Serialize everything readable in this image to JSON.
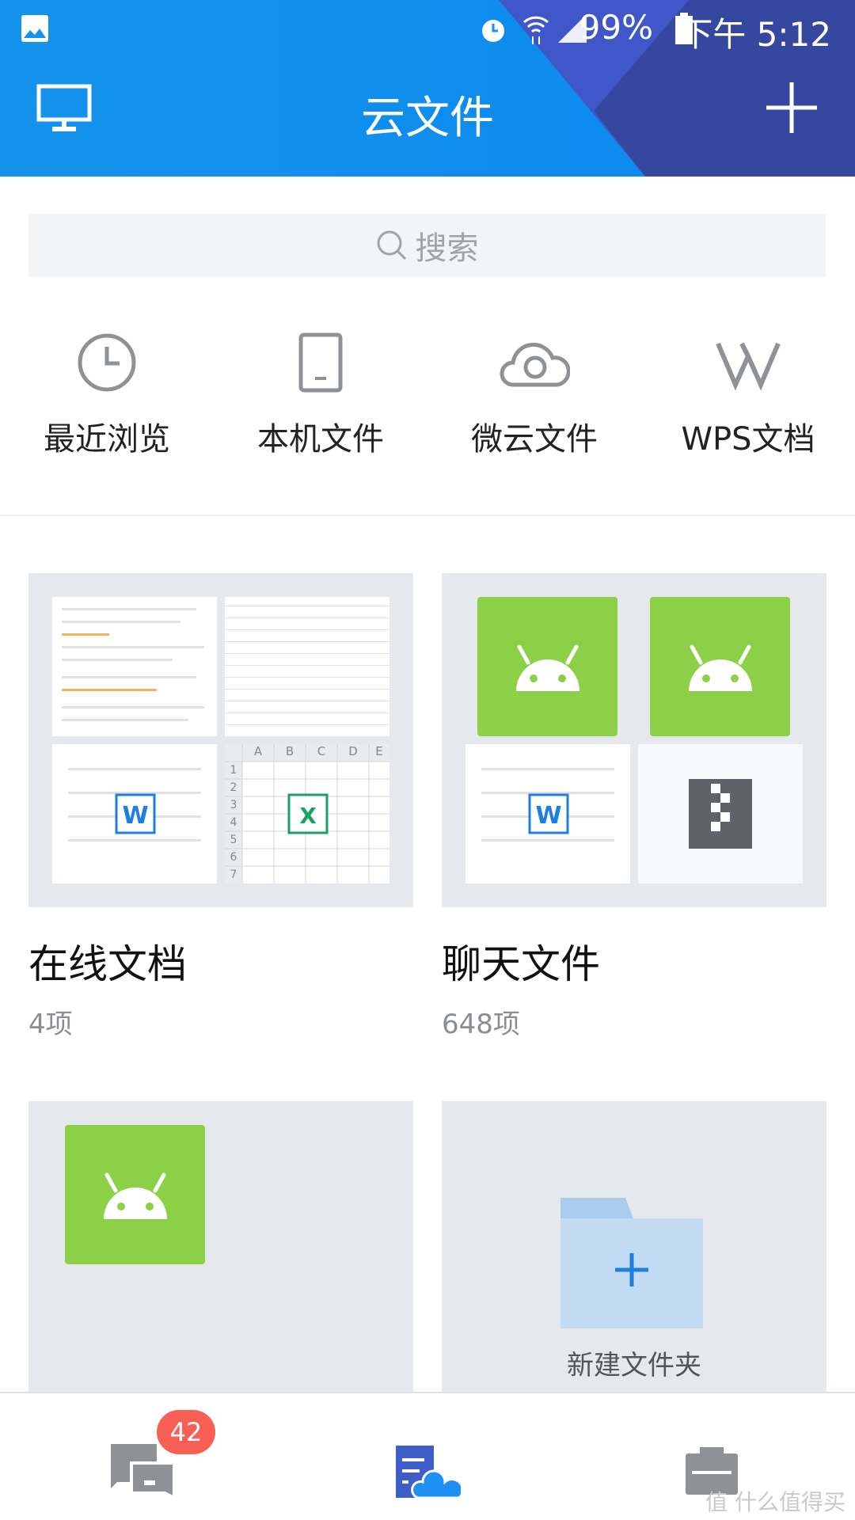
{
  "status_bar": {
    "battery": "99%",
    "time": "下午 5:12",
    "icons": [
      "image-icon",
      "alarm-icon",
      "wifi-icon",
      "signal-icon",
      "battery-icon"
    ]
  },
  "header": {
    "title": "云文件",
    "left_icon": "monitor-icon",
    "right_icon": "plus-icon"
  },
  "search": {
    "placeholder": "搜索"
  },
  "quick_access": [
    {
      "label": "最近浏览",
      "icon": "clock-icon"
    },
    {
      "label": "本机文件",
      "icon": "phone-icon"
    },
    {
      "label": "微云文件",
      "icon": "cloud-icon"
    },
    {
      "label": "WPS文档",
      "icon": "wps-icon"
    }
  ],
  "folders": [
    {
      "title": "在线文档",
      "count": "4项"
    },
    {
      "title": "聊天文件",
      "count": "648项"
    },
    {
      "title": "",
      "count": ""
    },
    {
      "title": "新建文件夹"
    }
  ],
  "spreadsheet_thumb": {
    "cols": [
      "A",
      "B",
      "C",
      "D",
      "E"
    ],
    "rows": [
      "1",
      "2",
      "3",
      "4",
      "5",
      "6",
      "7"
    ]
  },
  "bottom_nav": {
    "badge": "42",
    "items": [
      "messages-icon",
      "cloud-files-icon",
      "briefcase-icon"
    ]
  },
  "watermark": "值 什么值得买",
  "colors": {
    "accent": "#0a88f0",
    "android": "#8bd046",
    "badge": "#f95f55",
    "folder": "#c3dbf2"
  }
}
